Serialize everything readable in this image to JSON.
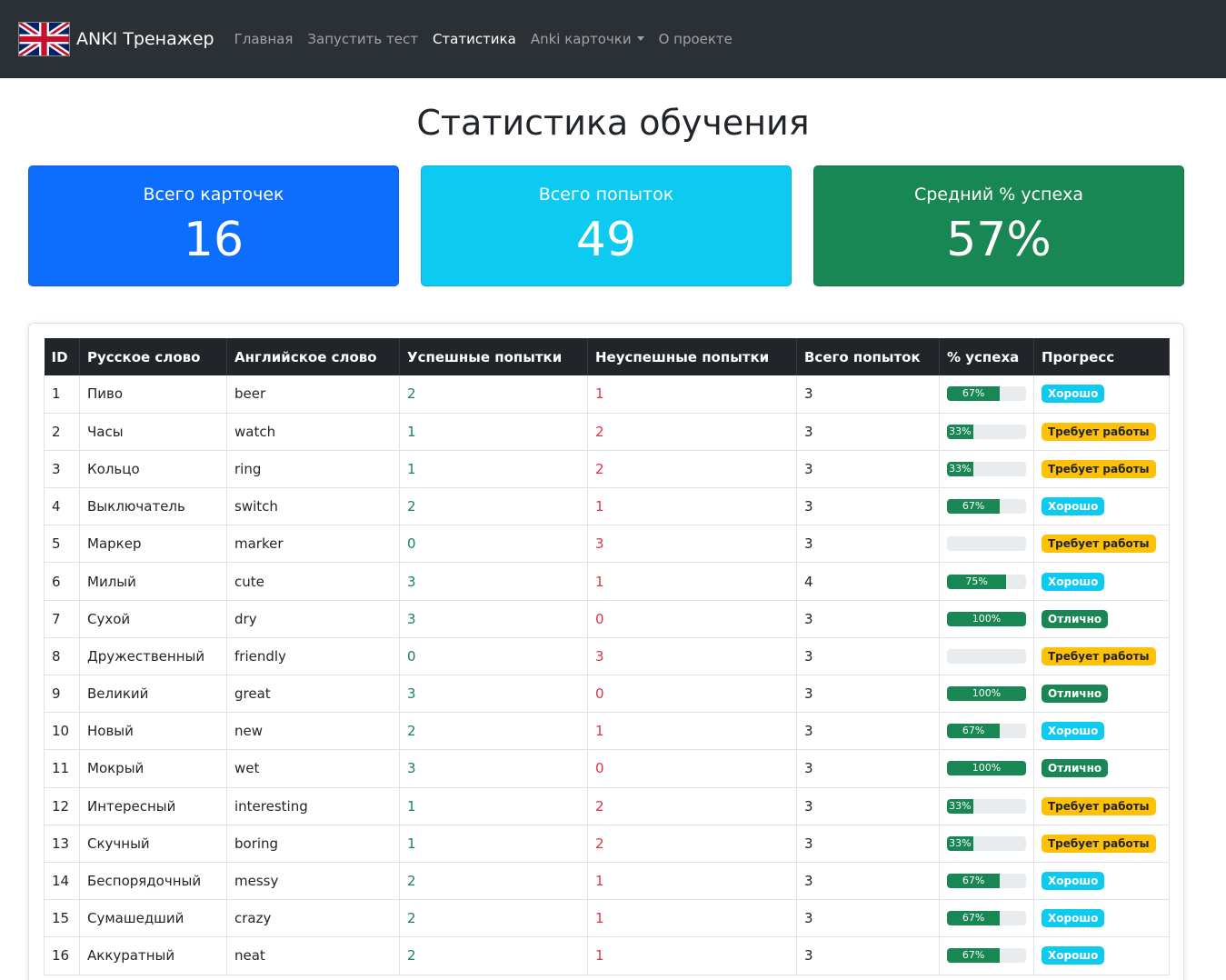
{
  "navbar": {
    "brand": "ANKI Тренажер",
    "links": [
      {
        "label": "Главная",
        "active": false
      },
      {
        "label": "Запустить тест",
        "active": false
      },
      {
        "label": "Статистика",
        "active": true
      },
      {
        "label": "Anki карточки",
        "active": false,
        "dropdown": true
      },
      {
        "label": "О проекте",
        "active": false
      }
    ]
  },
  "page": {
    "title": "Статистика обучения"
  },
  "stats": [
    {
      "label": "Всего карточек",
      "value": "16",
      "color": "#0d6efd"
    },
    {
      "label": "Всего попыток",
      "value": "49",
      "color": "#0dcaf0"
    },
    {
      "label": "Средний % успеха",
      "value": "57%",
      "color": "#198754"
    }
  ],
  "table": {
    "headers": [
      "ID",
      "Русское слово",
      "Английское слово",
      "Успешные попытки",
      "Неуспешные попытки",
      "Всего попыток",
      "% успеха",
      "Прогресс"
    ],
    "rows": [
      {
        "id": "1",
        "ru": "Пиво",
        "en": "beer",
        "success": "2",
        "fail": "1",
        "total": "3",
        "percent": 67,
        "percent_label": "67%",
        "status": "Хорошо",
        "status_type": "good"
      },
      {
        "id": "2",
        "ru": "Часы",
        "en": "watch",
        "success": "1",
        "fail": "2",
        "total": "3",
        "percent": 33,
        "percent_label": "33%",
        "status": "Требует работы",
        "status_type": "work"
      },
      {
        "id": "3",
        "ru": "Кольцо",
        "en": "ring",
        "success": "1",
        "fail": "2",
        "total": "3",
        "percent": 33,
        "percent_label": "33%",
        "status": "Требует работы",
        "status_type": "work"
      },
      {
        "id": "4",
        "ru": "Выключатель",
        "en": "switch",
        "success": "2",
        "fail": "1",
        "total": "3",
        "percent": 67,
        "percent_label": "67%",
        "status": "Хорошо",
        "status_type": "good"
      },
      {
        "id": "5",
        "ru": "Маркер",
        "en": "marker",
        "success": "0",
        "fail": "3",
        "total": "3",
        "percent": 0,
        "percent_label": "",
        "status": "Требует работы",
        "status_type": "work"
      },
      {
        "id": "6",
        "ru": "Милый",
        "en": "cute",
        "success": "3",
        "fail": "1",
        "total": "4",
        "percent": 75,
        "percent_label": "75%",
        "status": "Хорошо",
        "status_type": "good"
      },
      {
        "id": "7",
        "ru": "Сухой",
        "en": "dry",
        "success": "3",
        "fail": "0",
        "total": "3",
        "percent": 100,
        "percent_label": "100%",
        "status": "Отлично",
        "status_type": "excellent"
      },
      {
        "id": "8",
        "ru": "Дружественный",
        "en": "friendly",
        "success": "0",
        "fail": "3",
        "total": "3",
        "percent": 0,
        "percent_label": "",
        "status": "Требует работы",
        "status_type": "work"
      },
      {
        "id": "9",
        "ru": "Великий",
        "en": "great",
        "success": "3",
        "fail": "0",
        "total": "3",
        "percent": 100,
        "percent_label": "100%",
        "status": "Отлично",
        "status_type": "excellent"
      },
      {
        "id": "10",
        "ru": "Новый",
        "en": "new",
        "success": "2",
        "fail": "1",
        "total": "3",
        "percent": 67,
        "percent_label": "67%",
        "status": "Хорошо",
        "status_type": "good"
      },
      {
        "id": "11",
        "ru": "Мокрый",
        "en": "wet",
        "success": "3",
        "fail": "0",
        "total": "3",
        "percent": 100,
        "percent_label": "100%",
        "status": "Отлично",
        "status_type": "excellent"
      },
      {
        "id": "12",
        "ru": "Интересный",
        "en": "interesting",
        "success": "1",
        "fail": "2",
        "total": "3",
        "percent": 33,
        "percent_label": "33%",
        "status": "Требует работы",
        "status_type": "work"
      },
      {
        "id": "13",
        "ru": "Скучный",
        "en": "boring",
        "success": "1",
        "fail": "2",
        "total": "3",
        "percent": 33,
        "percent_label": "33%",
        "status": "Требует работы",
        "status_type": "work"
      },
      {
        "id": "14",
        "ru": "Беспорядочный",
        "en": "messy",
        "success": "2",
        "fail": "1",
        "total": "3",
        "percent": 67,
        "percent_label": "67%",
        "status": "Хорошо",
        "status_type": "good"
      },
      {
        "id": "15",
        "ru": "Сумашедший",
        "en": "crazy",
        "success": "2",
        "fail": "1",
        "total": "3",
        "percent": 67,
        "percent_label": "67%",
        "status": "Хорошо",
        "status_type": "good"
      },
      {
        "id": "16",
        "ru": "Аккуратный",
        "en": "neat",
        "success": "2",
        "fail": "1",
        "total": "3",
        "percent": 67,
        "percent_label": "67%",
        "status": "Хорошо",
        "status_type": "good"
      }
    ]
  }
}
